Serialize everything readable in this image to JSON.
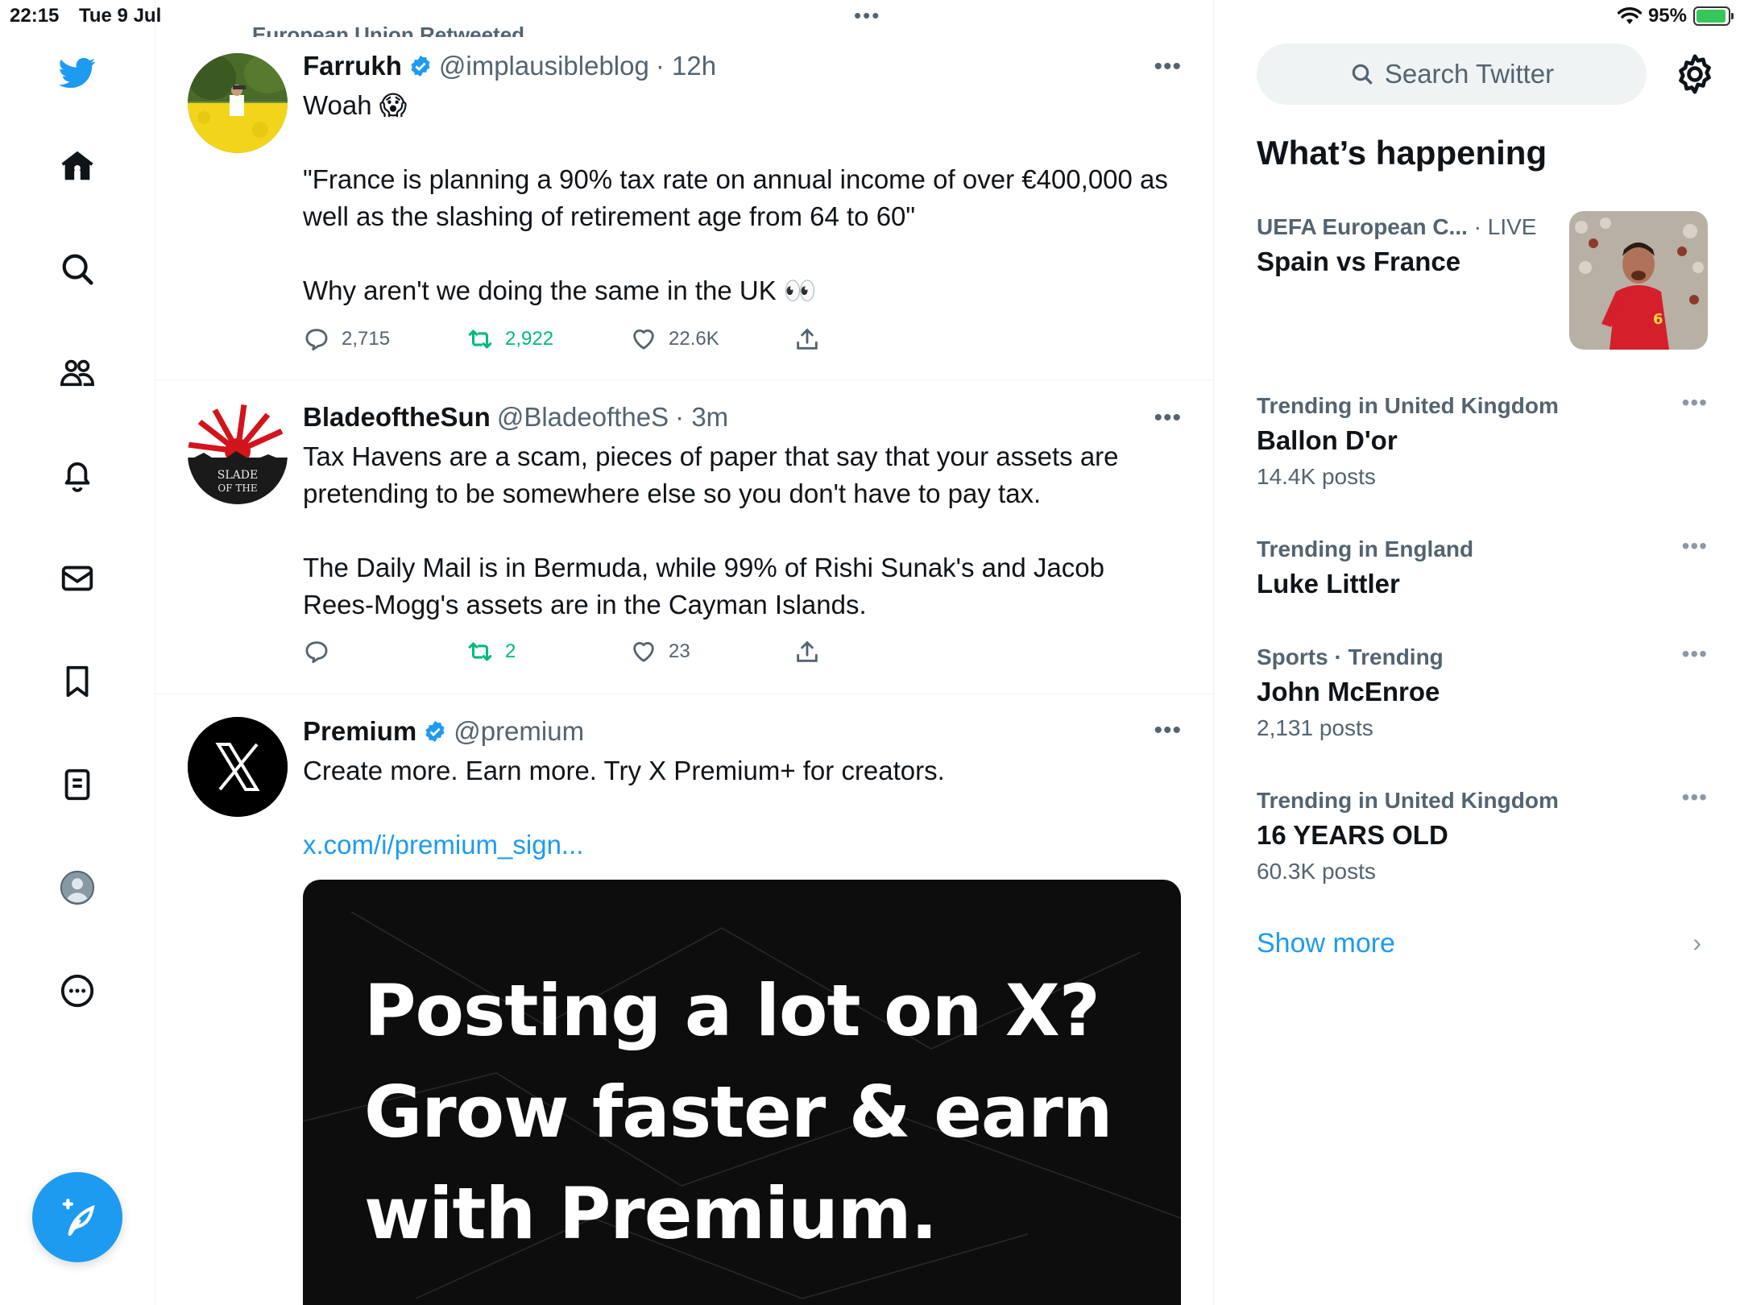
{
  "status_bar": {
    "time": "22:15",
    "date": "Tue 9 Jul",
    "battery": "95%",
    "battery_level": 0.95,
    "center_dots": "•••"
  },
  "nav": {
    "items": [
      "home-icon",
      "explore-icon",
      "communities-icon",
      "notifications-icon",
      "messages-icon",
      "bookmarks-icon",
      "lists-icon",
      "profile-icon",
      "more-icon"
    ],
    "compose": "compose-icon"
  },
  "timeline": {
    "retweet_header": "European Union Retweeted",
    "tweets": [
      {
        "name": "Farrukh",
        "verified": true,
        "handle": "@implausibleblog",
        "time": "· 12h",
        "text": "Woah 😱\n\n\"France is planning a 90% tax rate on annual income of over €400,000 as well as the slashing of retirement age from 64 to 60\"\n\nWhy aren't we doing the same in the UK 👀",
        "replies": "2,715",
        "retweets": "2,922",
        "likes": "22.6K",
        "more": "•••"
      },
      {
        "name": "BladeoftheSun",
        "verified": false,
        "handle": "@BladeoftheS",
        "time": "· 3m",
        "text": "Tax Havens are a scam, pieces of paper that say that your assets are pretending to be somewhere else so you don't have to pay tax.\n\nThe Daily Mail is in Bermuda, while 99% of Rishi Sunak's and Jacob Rees-Mogg's assets are in the Cayman Islands.",
        "replies": "",
        "retweets": "2",
        "likes": "23",
        "more": "•••",
        "avatar_text": "BLADE OF THE"
      },
      {
        "name": "Premium",
        "verified": true,
        "handle": "@premium",
        "time": "",
        "text": "Create more. Earn more. Try X Premium+ for creators.",
        "link": "x.com/i/premium_sign...",
        "more": "•••",
        "card_text": "Posting a lot on X?\nGrow faster & earn\nwith Premium."
      }
    ]
  },
  "sidebar": {
    "search_placeholder": "Search Twitter",
    "title": "What’s happening",
    "featured": {
      "context": "UEFA European C...",
      "live": "· LIVE",
      "title": "Spain vs France"
    },
    "trends": [
      {
        "context": "Trending in United Kingdom",
        "title": "Ballon D'or",
        "count": "14.4K posts"
      },
      {
        "context": "Trending in England",
        "title": "Luke Littler",
        "count": ""
      },
      {
        "context": "Sports · Trending",
        "title": "John McEnroe",
        "count": "2,131 posts"
      },
      {
        "context": "Trending in United Kingdom",
        "title": "16 YEARS OLD",
        "count": "60.3K posts"
      }
    ],
    "more_label": "•••",
    "show_more": "Show more",
    "chevron": "›"
  },
  "colors": {
    "accent": "#1d9bf0",
    "retweet": "#00ba7c",
    "muted": "#536471"
  }
}
